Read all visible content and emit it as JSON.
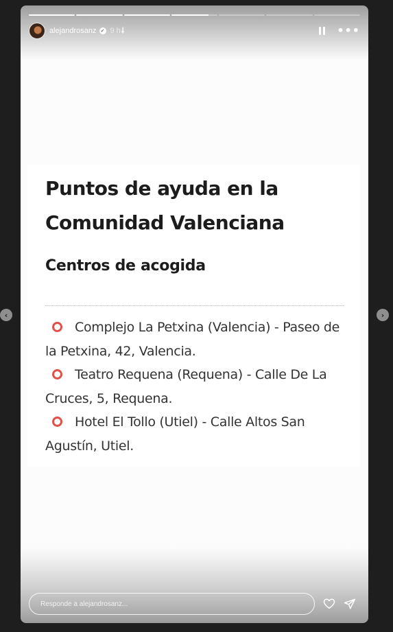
{
  "story": {
    "progress_fill": [
      1,
      1,
      1,
      0.8,
      0,
      0,
      0
    ],
    "username": "alejandrosanz",
    "time": "9 h",
    "icons": {
      "verified": "verified-badge-icon",
      "download": "down-arrow-icon",
      "pause": "pause-icon",
      "more": "more-options-icon",
      "heart": "heart-icon",
      "send": "send-icon",
      "prev": "chevron-left-icon",
      "next": "chevron-right-icon"
    }
  },
  "card": {
    "title": "Puntos de ayuda en la Comunidad Valenciana",
    "subtitle": "Centros de acogida",
    "items": [
      "Complejo La Petxina (Valencia) - Paseo de la Petxina, 42, Valencia.",
      "Teatro Requena (Requena) - Calle De La Cruces, 5, Requena.",
      "Hotel El Tollo (Utiel) - Calle Altos San Agustín, Utiel."
    ],
    "bullet_color": "#e0514a"
  },
  "footer": {
    "reply_placeholder": "Responde a alejandrosanz..."
  }
}
